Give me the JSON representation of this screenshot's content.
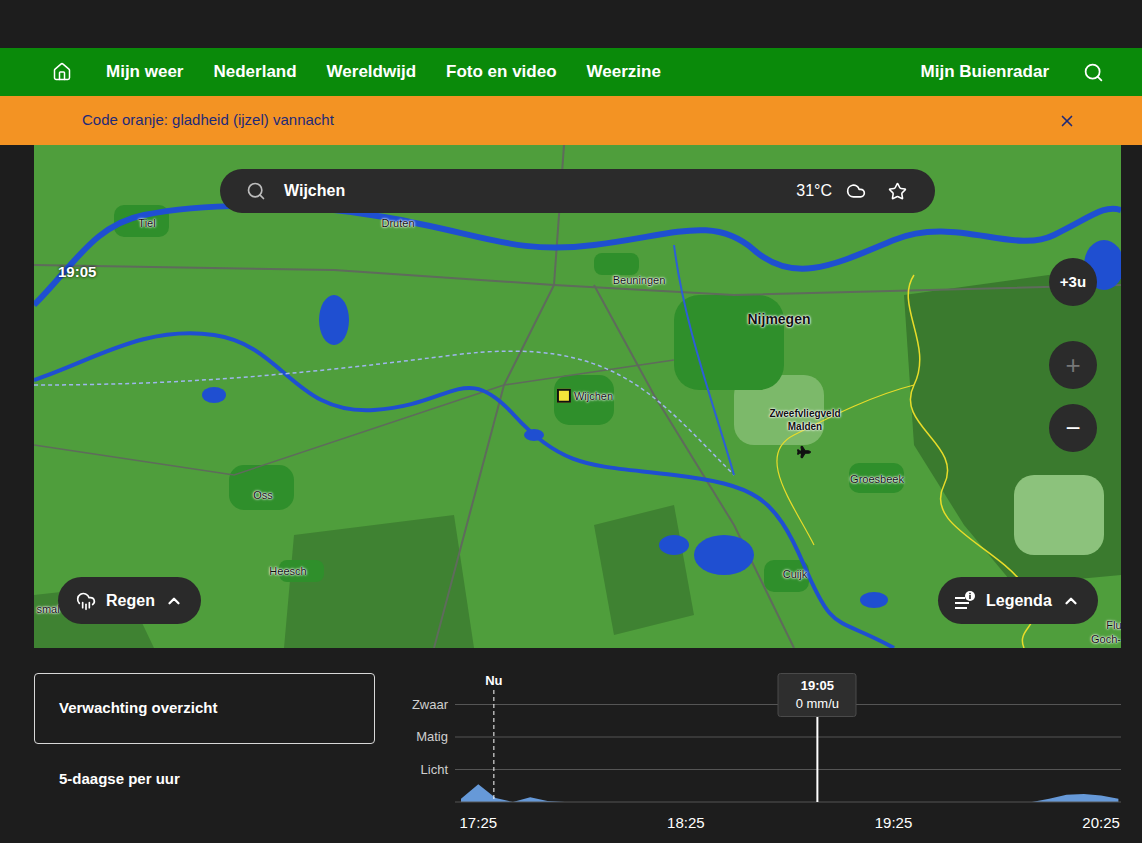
{
  "top_nav": {
    "items": [
      "Mijn weer",
      "Nederland",
      "Wereldwijd",
      "Foto en video",
      "Weerzine"
    ],
    "account": "Mijn Buienradar"
  },
  "alert": {
    "text": "Code oranje: gladheid (ijzel) vannacht"
  },
  "search": {
    "value": "Wijchen",
    "temperature": "31°C"
  },
  "map": {
    "time": "19:05",
    "labels": [
      {
        "text": "Tiel",
        "kind": "town"
      },
      {
        "text": "Druten",
        "kind": "town"
      },
      {
        "text": "Beuningen",
        "kind": "town"
      },
      {
        "text": "Nijmegen",
        "kind": "city"
      },
      {
        "text": "Wijchen",
        "kind": "selected"
      },
      {
        "text": "Zweefvliegveld Malden",
        "kind": "airfield"
      },
      {
        "text": "Oss",
        "kind": "town"
      },
      {
        "text": "Groesbeek",
        "kind": "town"
      },
      {
        "text": "Heesch",
        "kind": "town"
      },
      {
        "text": "Cuijk",
        "kind": "town"
      },
      {
        "text": "smal",
        "kind": "town"
      },
      {
        "text": "Flu",
        "kind": "town"
      },
      {
        "text": "Goch-",
        "kind": "town"
      }
    ],
    "controls": [
      {
        "label": "+3u",
        "disabled": false
      },
      {
        "label": "+",
        "disabled": true
      },
      {
        "label": "−",
        "disabled": false
      }
    ],
    "layer_button": "Regen",
    "legend_button": "Legenda"
  },
  "forecast_tabs": [
    {
      "label": "Verwachting overzicht",
      "selected": true
    },
    {
      "label": "5-daagse per uur",
      "selected": false
    }
  ],
  "chart": {
    "y_ticks": [
      {
        "label": "Zwaar",
        "value": 3
      },
      {
        "label": "Matig",
        "value": 2
      },
      {
        "label": "Licht",
        "value": 1
      }
    ],
    "x_ticks": [
      {
        "label": "17:25",
        "index": 1
      },
      {
        "label": "18:25",
        "index": 13
      },
      {
        "label": "19:25",
        "index": 25
      },
      {
        "label": "20:25",
        "index": 37
      }
    ],
    "values": [
      0.1,
      0.55,
      0.12,
      0,
      0.15,
      0.03,
      0,
      0,
      0,
      0,
      0,
      0,
      0,
      0,
      0,
      0,
      0,
      0,
      0,
      0,
      0,
      0,
      0,
      0,
      0,
      0,
      0,
      0,
      0,
      0,
      0,
      0,
      0,
      0,
      0.1,
      0.22,
      0.25,
      0.2,
      0.1
    ],
    "now": {
      "label": "Nu",
      "index": 1.9
    },
    "cursor": {
      "time": "19:05",
      "reading": "0 mm/u",
      "index": 20.6
    }
  }
}
